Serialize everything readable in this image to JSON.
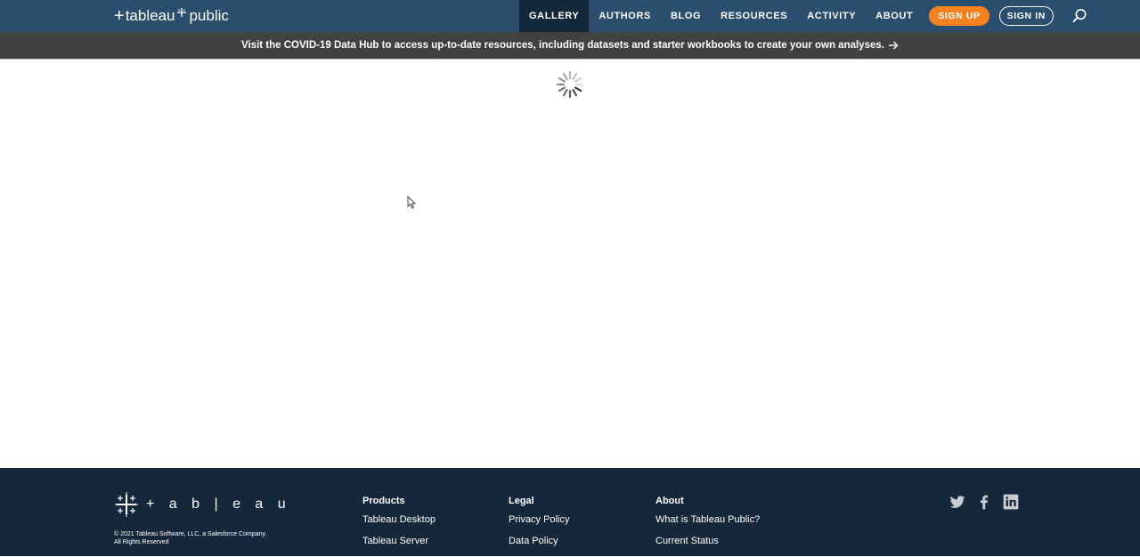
{
  "header": {
    "logo_part1": "tableau",
    "logo_part2": "public",
    "nav": [
      {
        "label": "GALLERY",
        "active": true
      },
      {
        "label": "AUTHORS"
      },
      {
        "label": "BLOG"
      },
      {
        "label": "RESOURCES"
      },
      {
        "label": "ACTIVITY"
      },
      {
        "label": "ABOUT"
      }
    ],
    "signup_label": "SIGN UP",
    "signin_label": "SIGN IN",
    "search_icon": "search-icon"
  },
  "banner": {
    "text": "Visit the COVID-19 Data Hub to access up-to-date resources, including datasets and starter workbooks to create your own analyses."
  },
  "content": {
    "loading_icon": "spinner-icon"
  },
  "footer": {
    "wordmark": "+ a b | e a u",
    "copyright_line1": "© 2021 Tableau Software, LLC, a Salesforce Company.",
    "copyright_line2": "All Rights Reserved",
    "columns": {
      "products": {
        "heading": "Products",
        "links": [
          "Tableau Desktop",
          "Tableau Server"
        ]
      },
      "legal": {
        "heading": "Legal",
        "links": [
          "Privacy Policy",
          "Data Policy"
        ]
      },
      "about": {
        "heading": "About",
        "links": [
          "What is Tableau Public?",
          "Current Status"
        ]
      }
    },
    "social": [
      "twitter-icon",
      "facebook-icon",
      "linkedin-icon"
    ]
  },
  "colors": {
    "nav_bg": "#2b4d6e",
    "nav_active_bg": "#14283c",
    "banner_bg": "#414141",
    "signup_bg": "#f5821f",
    "footer_bg": "#15273a"
  }
}
